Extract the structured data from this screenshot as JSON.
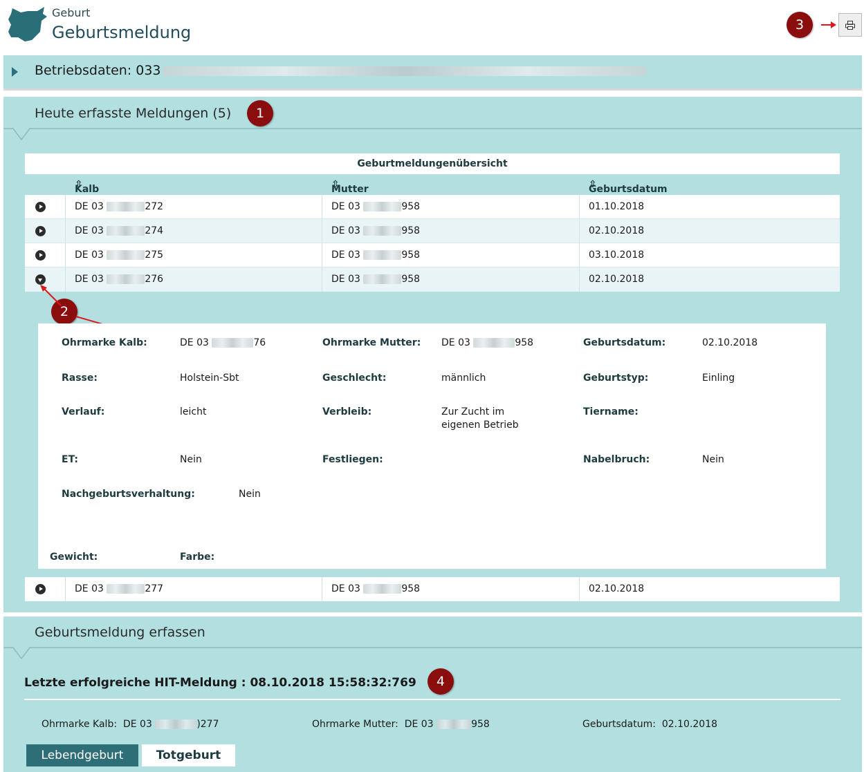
{
  "header": {
    "subtitle": "Geburt",
    "title": "Geburtsmeldung",
    "logo_icon": "cow-head-icon",
    "print_icon": "printer-icon"
  },
  "annotations": [
    "1",
    "2",
    "3",
    "4"
  ],
  "betriebsdaten": {
    "label": "Betriebsdaten: 033"
  },
  "heute": {
    "title": "Heute erfasste Meldungen (5)",
    "table": {
      "caption": "Geburtmeldungenübersicht",
      "columns": [
        "Kalb",
        "Mutter",
        "Geburtsdatum"
      ],
      "sort_glyph": "⇳",
      "rows": [
        {
          "kalb_prefix": "DE 03",
          "kalb_suffix": "272",
          "mutter_prefix": "DE 03",
          "mutter_suffix": "958",
          "datum": "01.10.2018"
        },
        {
          "kalb_prefix": "DE 03",
          "kalb_suffix": "274",
          "mutter_prefix": "DE 03",
          "mutter_suffix": "958",
          "datum": "02.10.2018"
        },
        {
          "kalb_prefix": "DE 03",
          "kalb_suffix": "275",
          "mutter_prefix": "DE 03",
          "mutter_suffix": "958",
          "datum": "03.10.2018"
        },
        {
          "kalb_prefix": "DE 03",
          "kalb_suffix": "276",
          "mutter_prefix": "DE 03",
          "mutter_suffix": "958",
          "datum": "02.10.2018"
        },
        {
          "kalb_prefix": "DE 03",
          "kalb_suffix": "277",
          "mutter_prefix": "DE 03",
          "mutter_suffix": "958",
          "datum": "02.10.2018"
        }
      ]
    },
    "detail": {
      "ohrmarke_kalb_label": "Ohrmarke Kalb:",
      "ohrmarke_kalb_prefix": "DE 03",
      "ohrmarke_kalb_suffix": "76",
      "ohrmarke_mutter_label": "Ohrmarke Mutter:",
      "ohrmarke_mutter_prefix": "DE 03",
      "ohrmarke_mutter_suffix": "958",
      "geburtsdatum_label": "Geburtsdatum:",
      "geburtsdatum": "02.10.2018",
      "rasse_label": "Rasse:",
      "rasse": "Holstein-Sbt",
      "geschlecht_label": "Geschlecht:",
      "geschlecht": "männlich",
      "geburtstyp_label": "Geburtstyp:",
      "geburtstyp": "Einling",
      "verlauf_label": "Verlauf:",
      "verlauf": "leicht",
      "verbleib_label": "Verbleib:",
      "verbleib_line1": "Zur Zucht im",
      "verbleib_line2": "eigenen Betrieb",
      "tiername_label": "Tiername:",
      "et_label": "ET:",
      "et": "Nein",
      "festliegen_label": "Festliegen:",
      "nabelbruch_label": "Nabelbruch:",
      "nabelbruch": "Nein",
      "nachgeburt_label": "Nachgeburtsverhaltung:",
      "nachgeburt": "Nein",
      "gewicht_label": "Gewicht:",
      "farbe_label": "Farbe:"
    }
  },
  "erfassen": {
    "title": "Geburtsmeldung erfassen",
    "last_hit": "Letzte erfolgreiche HIT-Meldung : 08.10.2018 15:58:32:769",
    "summary": {
      "kalb_label": "Ohrmarke Kalb:",
      "kalb_prefix": "DE 03",
      "kalb_suffix": ")277",
      "mutter_label": "Ohrmarke Mutter:",
      "mutter_prefix": "DE 03",
      "mutter_suffix": "958",
      "datum_label": "Geburtsdatum:",
      "datum": "02.10.2018"
    },
    "tabs": [
      "Lebendgeburt",
      "Totgeburt"
    ]
  },
  "colors": {
    "panel": "#b2dfe0",
    "badge": "#8b0e0e",
    "active_tab": "#2e6e77",
    "header_text": "#1f4d5b"
  }
}
